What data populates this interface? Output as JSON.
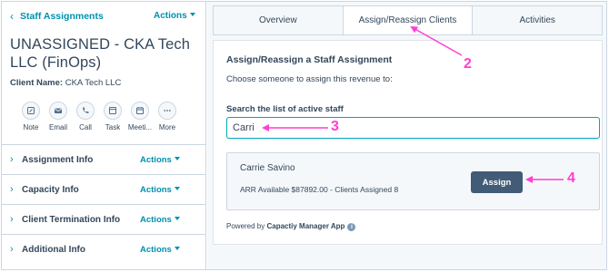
{
  "sidebar": {
    "back_label": "Staff Assignments",
    "actions_label": "Actions",
    "record_title": "UNASSIGNED - CKA Tech LLC (FinOps)",
    "client_name_label": "Client Name:",
    "client_name_value": "CKA Tech LLC",
    "quick_actions": [
      {
        "label": "Note",
        "icon": "note-icon"
      },
      {
        "label": "Email",
        "icon": "email-icon"
      },
      {
        "label": "Call",
        "icon": "call-icon"
      },
      {
        "label": "Task",
        "icon": "task-icon"
      },
      {
        "label": "Meeti...",
        "icon": "meeting-icon"
      },
      {
        "label": "More",
        "icon": "more-icon"
      }
    ],
    "sections": [
      {
        "label": "Assignment Info",
        "actions": "Actions"
      },
      {
        "label": "Capacity Info",
        "actions": "Actions"
      },
      {
        "label": "Client Termination Info",
        "actions": "Actions"
      },
      {
        "label": "Additional Info",
        "actions": "Actions"
      }
    ]
  },
  "tabs": [
    {
      "label": "Overview",
      "active": false
    },
    {
      "label": "Assign/Reassign Clients",
      "active": true
    },
    {
      "label": "Activities",
      "active": false
    }
  ],
  "panel": {
    "title": "Assign/Reassign a Staff Assignment",
    "subtitle": "Choose someone to assign this revenue to:",
    "search_label": "Search the list of active staff",
    "search_value": "Carri",
    "result": {
      "name": "Carrie Savino",
      "meta": "ARR Available $87892.00 - Clients Assigned 8",
      "button_label": "Assign"
    },
    "powered_prefix": "Powered by",
    "powered_app": "Capactiy Manager App"
  },
  "annotations": {
    "color": "#ff3fd2",
    "labels": [
      "2",
      "3",
      "4"
    ]
  },
  "colors": {
    "link": "#0091ae",
    "text": "#33475b",
    "button": "#425b76",
    "focus": "#00a4bd",
    "annotation": "#ff3fd2"
  }
}
